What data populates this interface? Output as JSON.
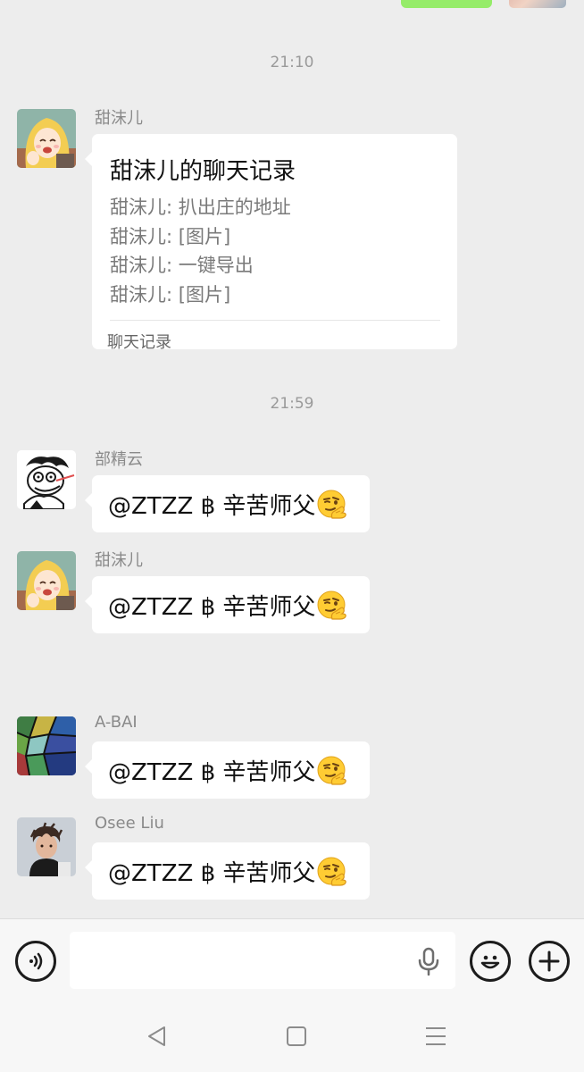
{
  "chat": {
    "messages": [
      {
        "type": "timestamp",
        "text": "21:10"
      },
      {
        "type": "chat-record",
        "sender": "甜沫儿",
        "avatar": "cartoon-girl-blonde",
        "card": {
          "title": "甜沫儿的聊天记录",
          "lines": [
            "甜沫儿: 扒出庄的地址",
            "甜沫儿: [图片]",
            "甜沫儿: 一键导出",
            "甜沫儿: [图片]"
          ],
          "footer": "聊天记录"
        }
      },
      {
        "type": "timestamp",
        "text": "21:59"
      },
      {
        "type": "text",
        "sender": "部精云",
        "avatar": "cartoon-sketch-face",
        "text": "@ZTZZ ฿ 辛苦师父",
        "emoji": "salute-face-emoji"
      },
      {
        "type": "text",
        "sender": "甜沫儿",
        "avatar": "cartoon-girl-blonde",
        "text": "@ZTZZ ฿ 辛苦师父",
        "emoji": "salute-face-emoji"
      },
      {
        "type": "text",
        "sender": "A-BAI",
        "avatar": "stained-glass",
        "text": "@ZTZZ ฿ 辛苦师父",
        "emoji": "salute-face-emoji"
      },
      {
        "type": "text",
        "sender": "Osee Liu",
        "avatar": "man-portrait",
        "text": "@ZTZZ ฿ 辛苦师父",
        "emoji": "salute-face-emoji"
      }
    ]
  },
  "input_bar": {
    "voice_icon": "voice-icon",
    "input_value": "",
    "mic_icon": "microphone-icon",
    "emoji_icon": "smiley-icon",
    "more_icon": "plus-icon"
  },
  "nav_bar": {
    "icons": [
      "back-triangle-icon",
      "home-square-icon",
      "menu-lines-icon"
    ]
  },
  "colors": {
    "background": "#ededed",
    "bubble_received": "#ffffff",
    "bubble_sent": "#95ec69",
    "timestamp_text": "#9a9a9a",
    "sender_text": "#8a8a8a"
  }
}
